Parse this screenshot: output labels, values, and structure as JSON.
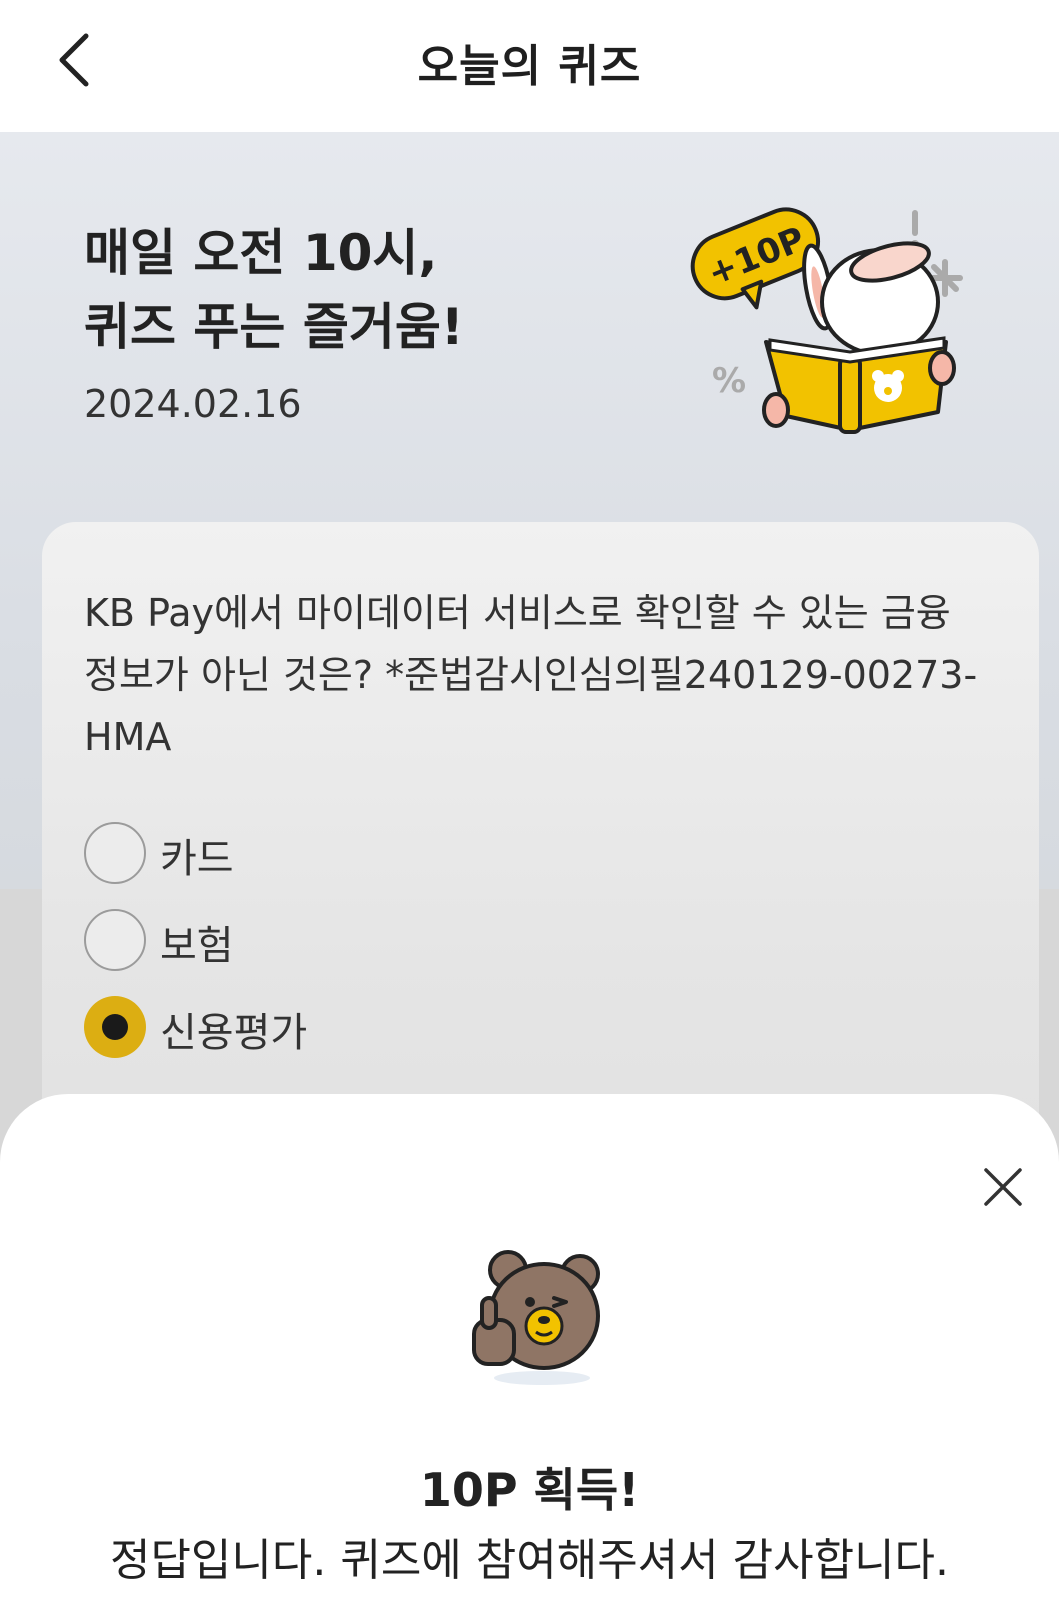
{
  "header": {
    "title": "오늘의 퀴즈",
    "back_icon": "chevron-left-icon"
  },
  "hero": {
    "title_line1": "매일 오전 10시,",
    "title_line2": "퀴즈 푸는 즐거움!",
    "date": "2024.02.16",
    "badge_text": "+10P",
    "accent_color": "#f2c200"
  },
  "quiz": {
    "question": "KB Pay에서 마이데이터 서비스로 확인할 수 있는 금융 정보가 아닌 것은? *준법감시인심의필240129-00273-HMA",
    "options": [
      {
        "label": "카드",
        "selected": false
      },
      {
        "label": "보험",
        "selected": false
      },
      {
        "label": "신용평가",
        "selected": true
      }
    ]
  },
  "result_sheet": {
    "title": "10P 획득!",
    "message": "정답입니다. 퀴즈에 참여해주셔서 감사합니다.",
    "close_icon": "close-icon",
    "selected_color": "#dcae12"
  }
}
